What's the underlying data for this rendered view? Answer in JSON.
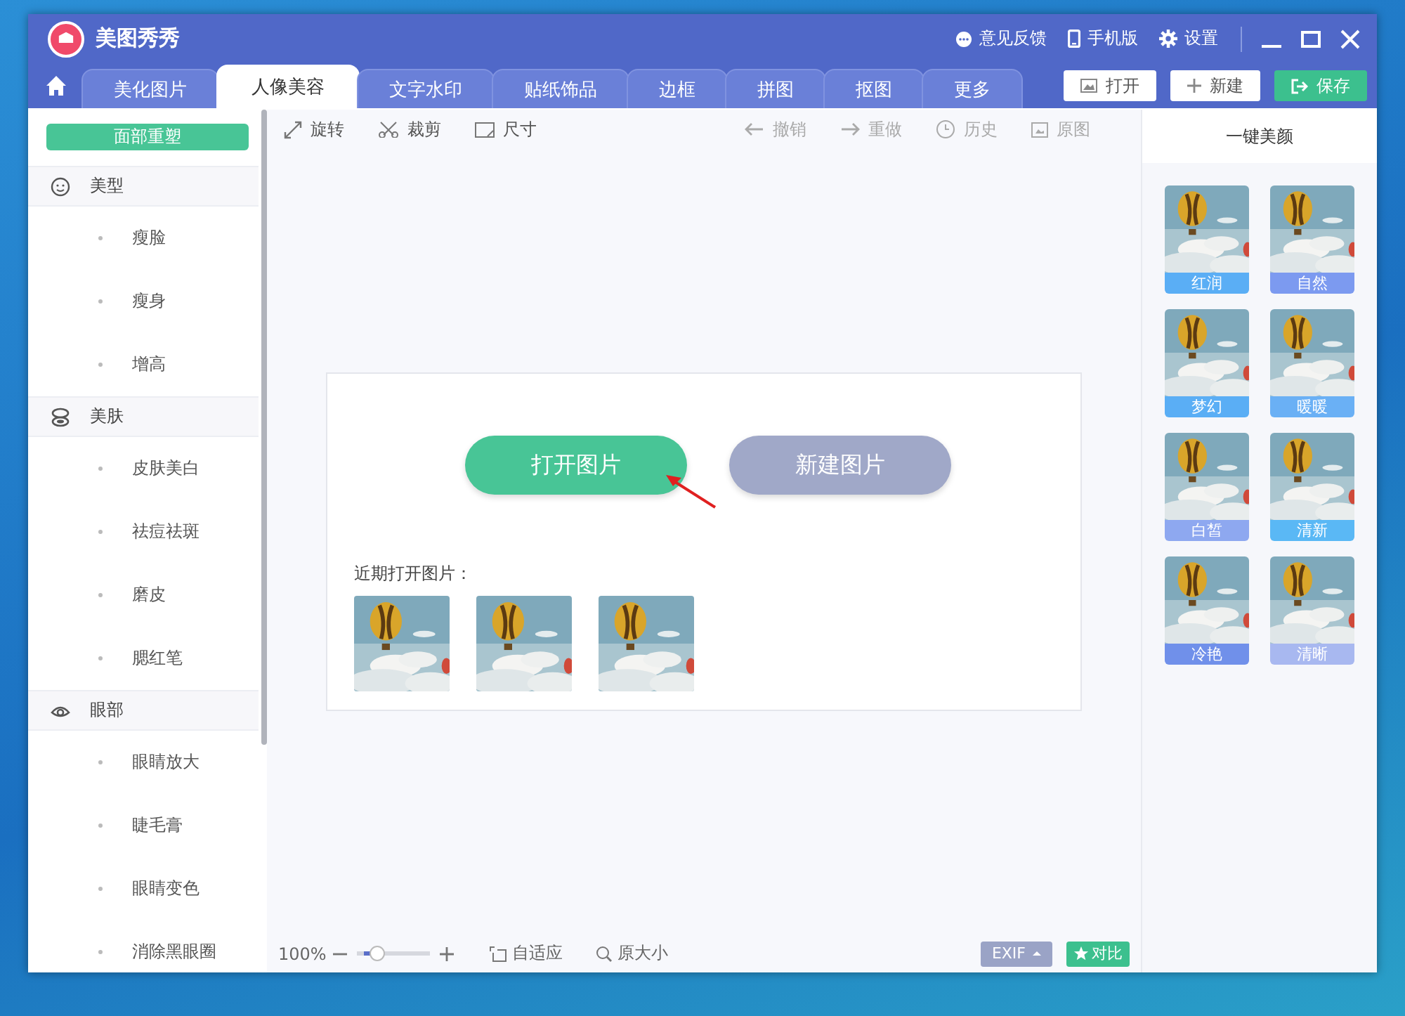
{
  "window": {
    "title": "美图秀秀",
    "links": [
      "意见反馈",
      "手机版",
      "设置"
    ]
  },
  "tabs": [
    {
      "label": "美化图片",
      "selected": false
    },
    {
      "label": "人像美容",
      "selected": true
    },
    {
      "label": "文字水印",
      "selected": false
    },
    {
      "label": "贴纸饰品",
      "selected": false
    },
    {
      "label": "边框",
      "selected": false
    },
    {
      "label": "拼图",
      "selected": false
    },
    {
      "label": "抠图",
      "selected": false
    },
    {
      "label": "更多",
      "selected": false
    }
  ],
  "actions": [
    {
      "label": "打开",
      "kind": "open"
    },
    {
      "label": "新建",
      "kind": "new"
    },
    {
      "label": "保存",
      "kind": "save"
    }
  ],
  "sidebar": {
    "button": "面部重塑",
    "groups": [
      {
        "label": "美型",
        "children": [
          {
            "label": "瘦脸"
          },
          {
            "label": "瘦身"
          },
          {
            "label": "增高"
          }
        ]
      },
      {
        "label": "美肤",
        "children": [
          {
            "label": "皮肤美白"
          },
          {
            "label": "祛痘祛斑"
          },
          {
            "label": "磨皮"
          },
          {
            "label": "腮红笔"
          }
        ]
      },
      {
        "label": "眼部",
        "children": [
          {
            "label": "眼睛放大"
          },
          {
            "label": "睫毛膏"
          },
          {
            "label": "眼睛变色"
          },
          {
            "label": "消除黑眼圈"
          }
        ]
      }
    ]
  },
  "toolbar": [
    {
      "label": "旋转",
      "disabled": false
    },
    {
      "label": "裁剪",
      "disabled": false
    },
    {
      "label": "尺寸",
      "disabled": false
    },
    {
      "label": "撤销",
      "disabled": true
    },
    {
      "label": "重做",
      "disabled": true
    },
    {
      "label": "历史",
      "disabled": true
    },
    {
      "label": "原图",
      "disabled": true
    }
  ],
  "start": {
    "buttons": [
      {
        "label": "打开图片",
        "kind": "primary"
      },
      {
        "label": "新建图片",
        "kind": "secondary"
      }
    ],
    "recent_title": "近期打开图片："
  },
  "filters": {
    "title": "一键美颜",
    "items": [
      {
        "label": "红润",
        "color": "#5aaef5"
      },
      {
        "label": "自然",
        "color": "#7c9af0"
      },
      {
        "label": "梦幻",
        "color": "#5aaef5"
      },
      {
        "label": "暖暖",
        "color": "#6ab0f5"
      },
      {
        "label": "白皙",
        "color": "#8ea8f0"
      },
      {
        "label": "清新",
        "color": "#5ab8f5"
      },
      {
        "label": "冷艳",
        "color": "#7090ea"
      },
      {
        "label": "清晰",
        "color": "#a8b8f0"
      }
    ]
  },
  "status_bar": {
    "zoom": "100%",
    "zoom_slider": {
      "level": 0.2
    },
    "fit": "自适应",
    "actual": "原大小",
    "exif": "EXIF",
    "compare": "对比"
  }
}
